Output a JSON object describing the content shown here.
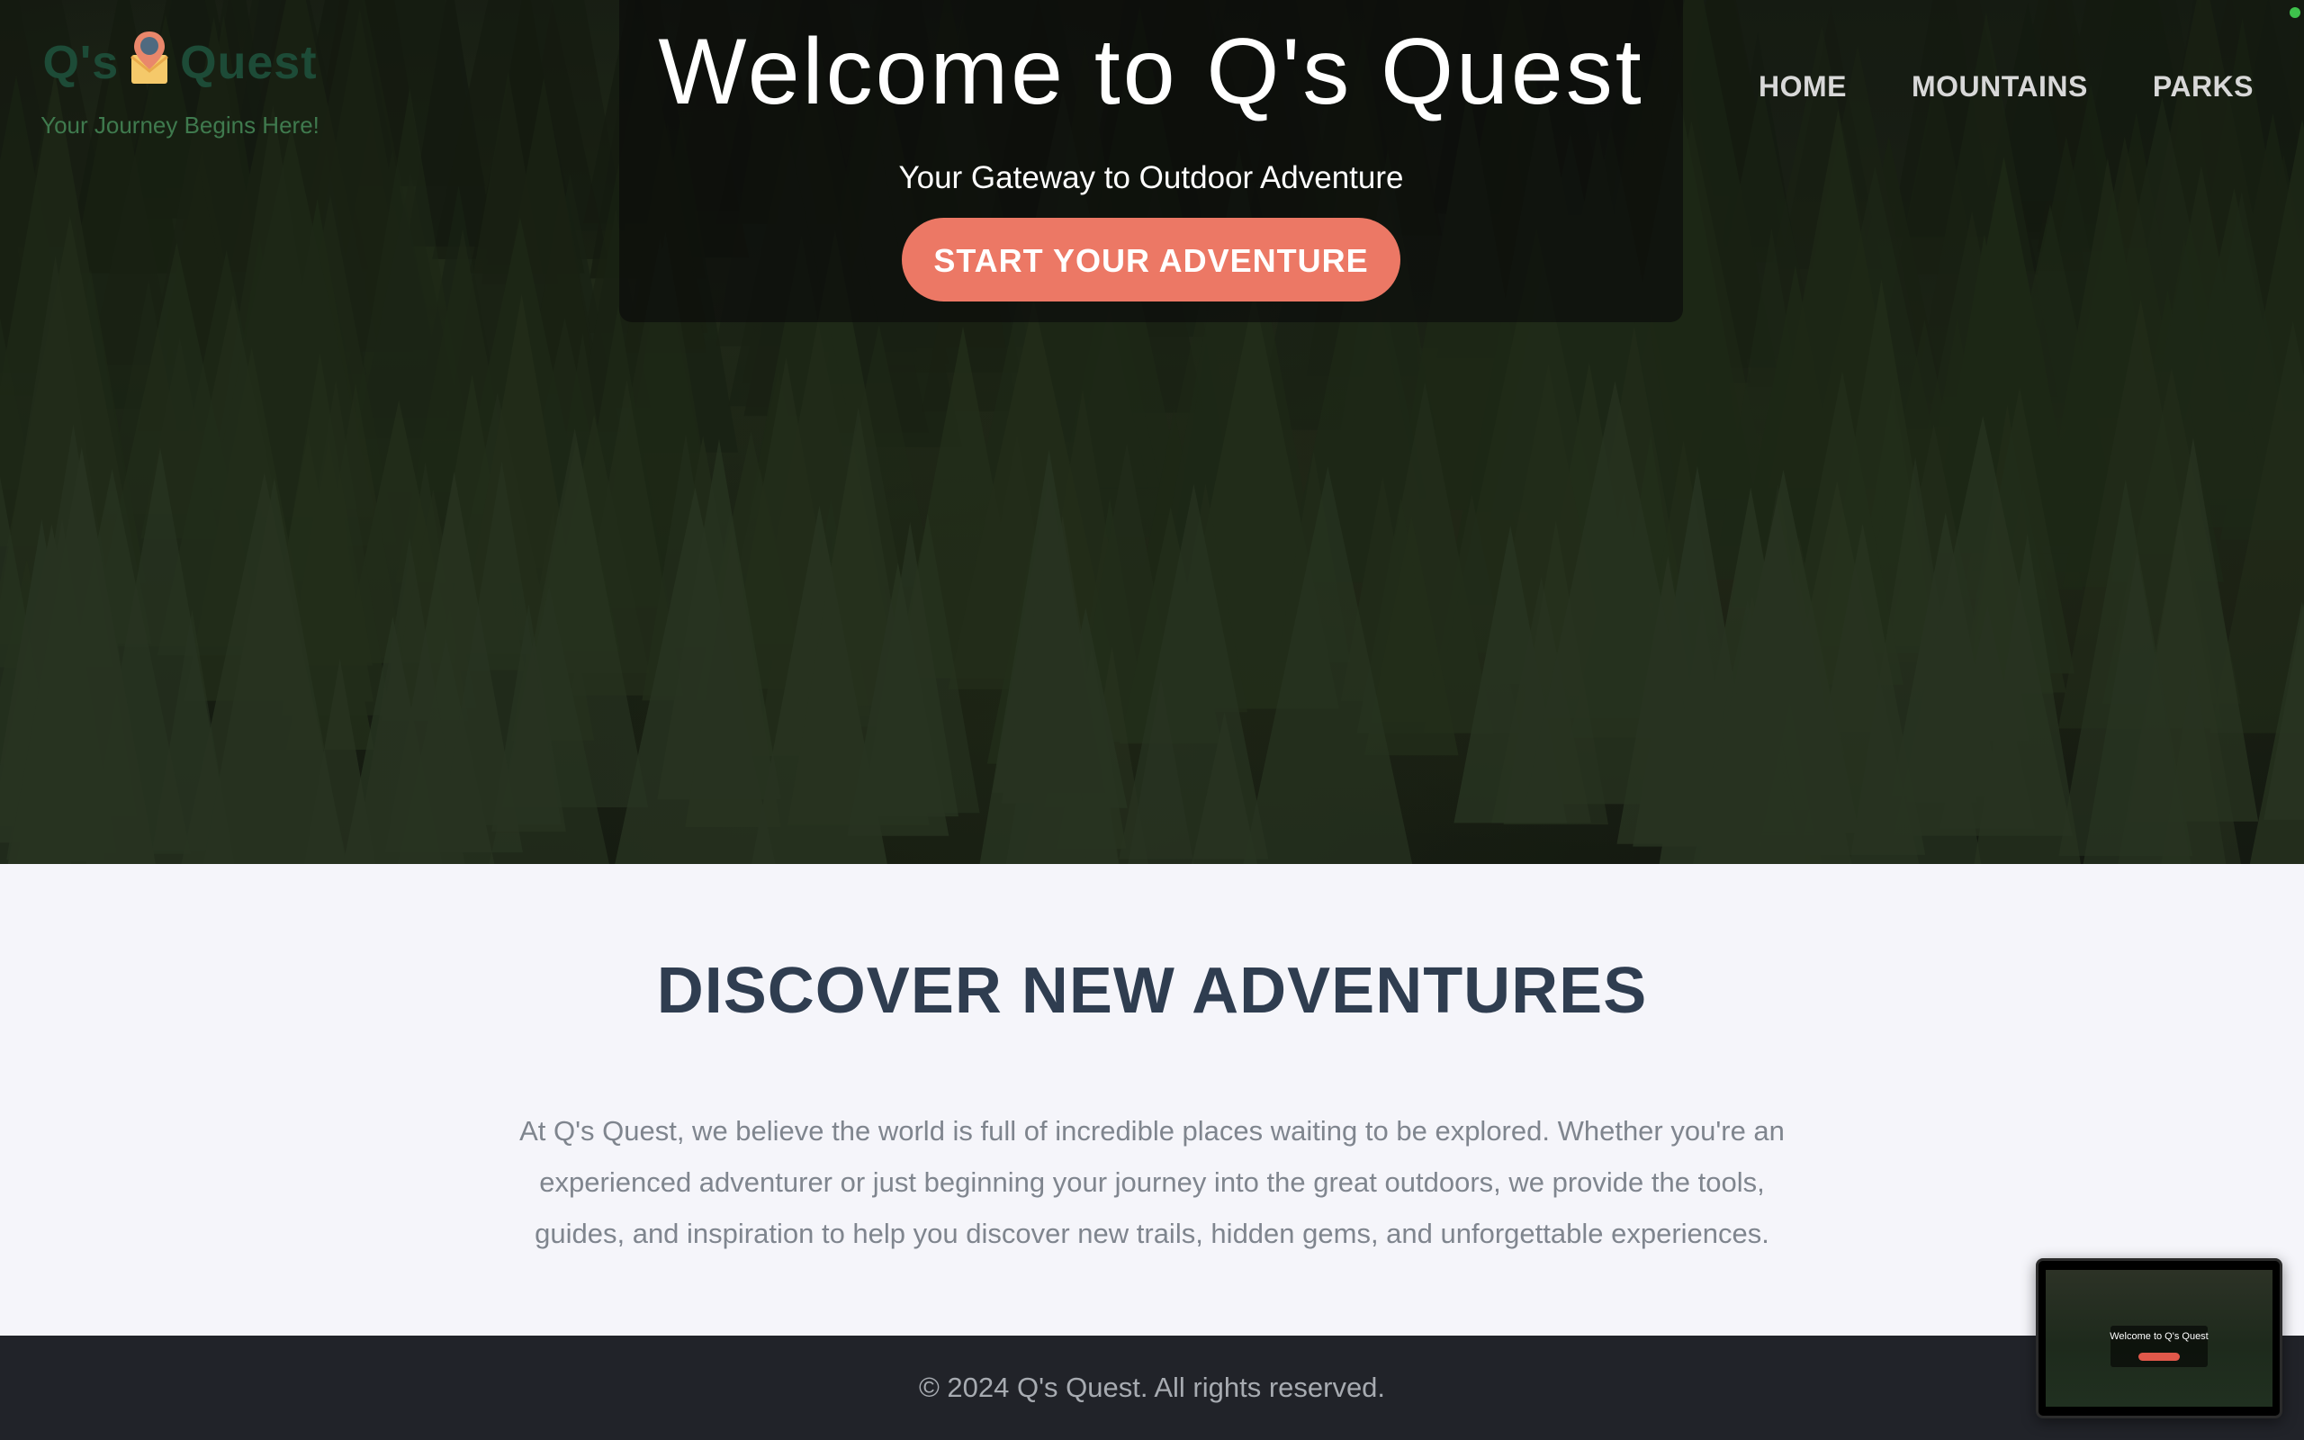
{
  "brand": {
    "name_left": "Q's",
    "name_right": "Quest",
    "tagline": "Your Journey Begins Here!"
  },
  "hero": {
    "title": "Welcome to Q's Quest",
    "subtitle": "Your Gateway to Outdoor Adventure",
    "cta_label": "START YOUR ADVENTURE"
  },
  "nav": {
    "items": [
      {
        "label": "HOME"
      },
      {
        "label": "MOUNTAINS"
      },
      {
        "label": "PARKS"
      }
    ]
  },
  "discover": {
    "title": "DISCOVER NEW ADVENTURES",
    "text": "At Q's Quest, we believe the world is full of incredible places waiting to be explored. Whether you're an experienced adventurer or just beginning your journey into the great outdoors, we provide the tools, guides, and inspiration to help you discover new trails, hidden gems, and unforgettable experiences."
  },
  "footer": {
    "text": "© 2024 Q's Quest. All rights reserved."
  },
  "thumbnail": {
    "title": "Welcome to Q's Quest"
  },
  "colors": {
    "accent": "#ec7865",
    "heading": "#2f3d50",
    "footer_bg": "#212329",
    "brand_green": "#1d4b37"
  }
}
